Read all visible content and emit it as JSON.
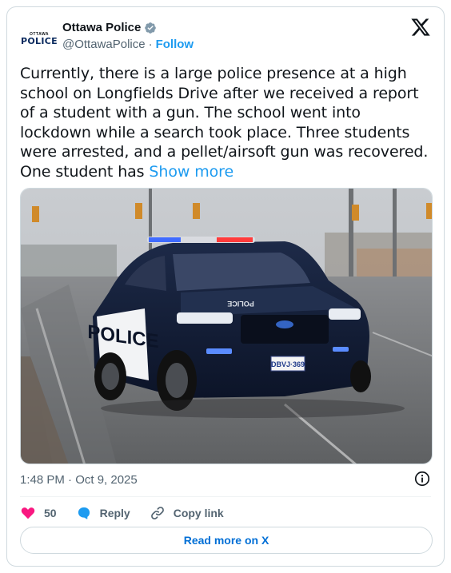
{
  "author": {
    "avatar_small_text": "OTTAWA",
    "avatar_big_text": "POLICE",
    "display_name": "Ottawa Police",
    "handle": "@OttawaPolice",
    "separator": "·",
    "follow_label": "Follow"
  },
  "tweet": {
    "text": "Currently, there is a large police presence at a high school on Longfields Drive after we received a report of a student with a gun. The school went into lockdown while a search took place. Three students were arrested, and a pellet/airsoft gun was recovered. One student has ",
    "show_more_label": "Show more",
    "timestamp": "1:48 PM · Oct 9, 2025"
  },
  "media": {
    "car_door_text": "POLICE",
    "hood_text": "POLICE",
    "plate_text": "DBVJ·369"
  },
  "actions": {
    "like_count": "50",
    "reply_label": "Reply",
    "copy_link_label": "Copy link"
  },
  "footer": {
    "read_more_label": "Read more on X"
  },
  "colors": {
    "accent": "#1d9bf0",
    "like": "#f91880",
    "muted": "#536471"
  }
}
